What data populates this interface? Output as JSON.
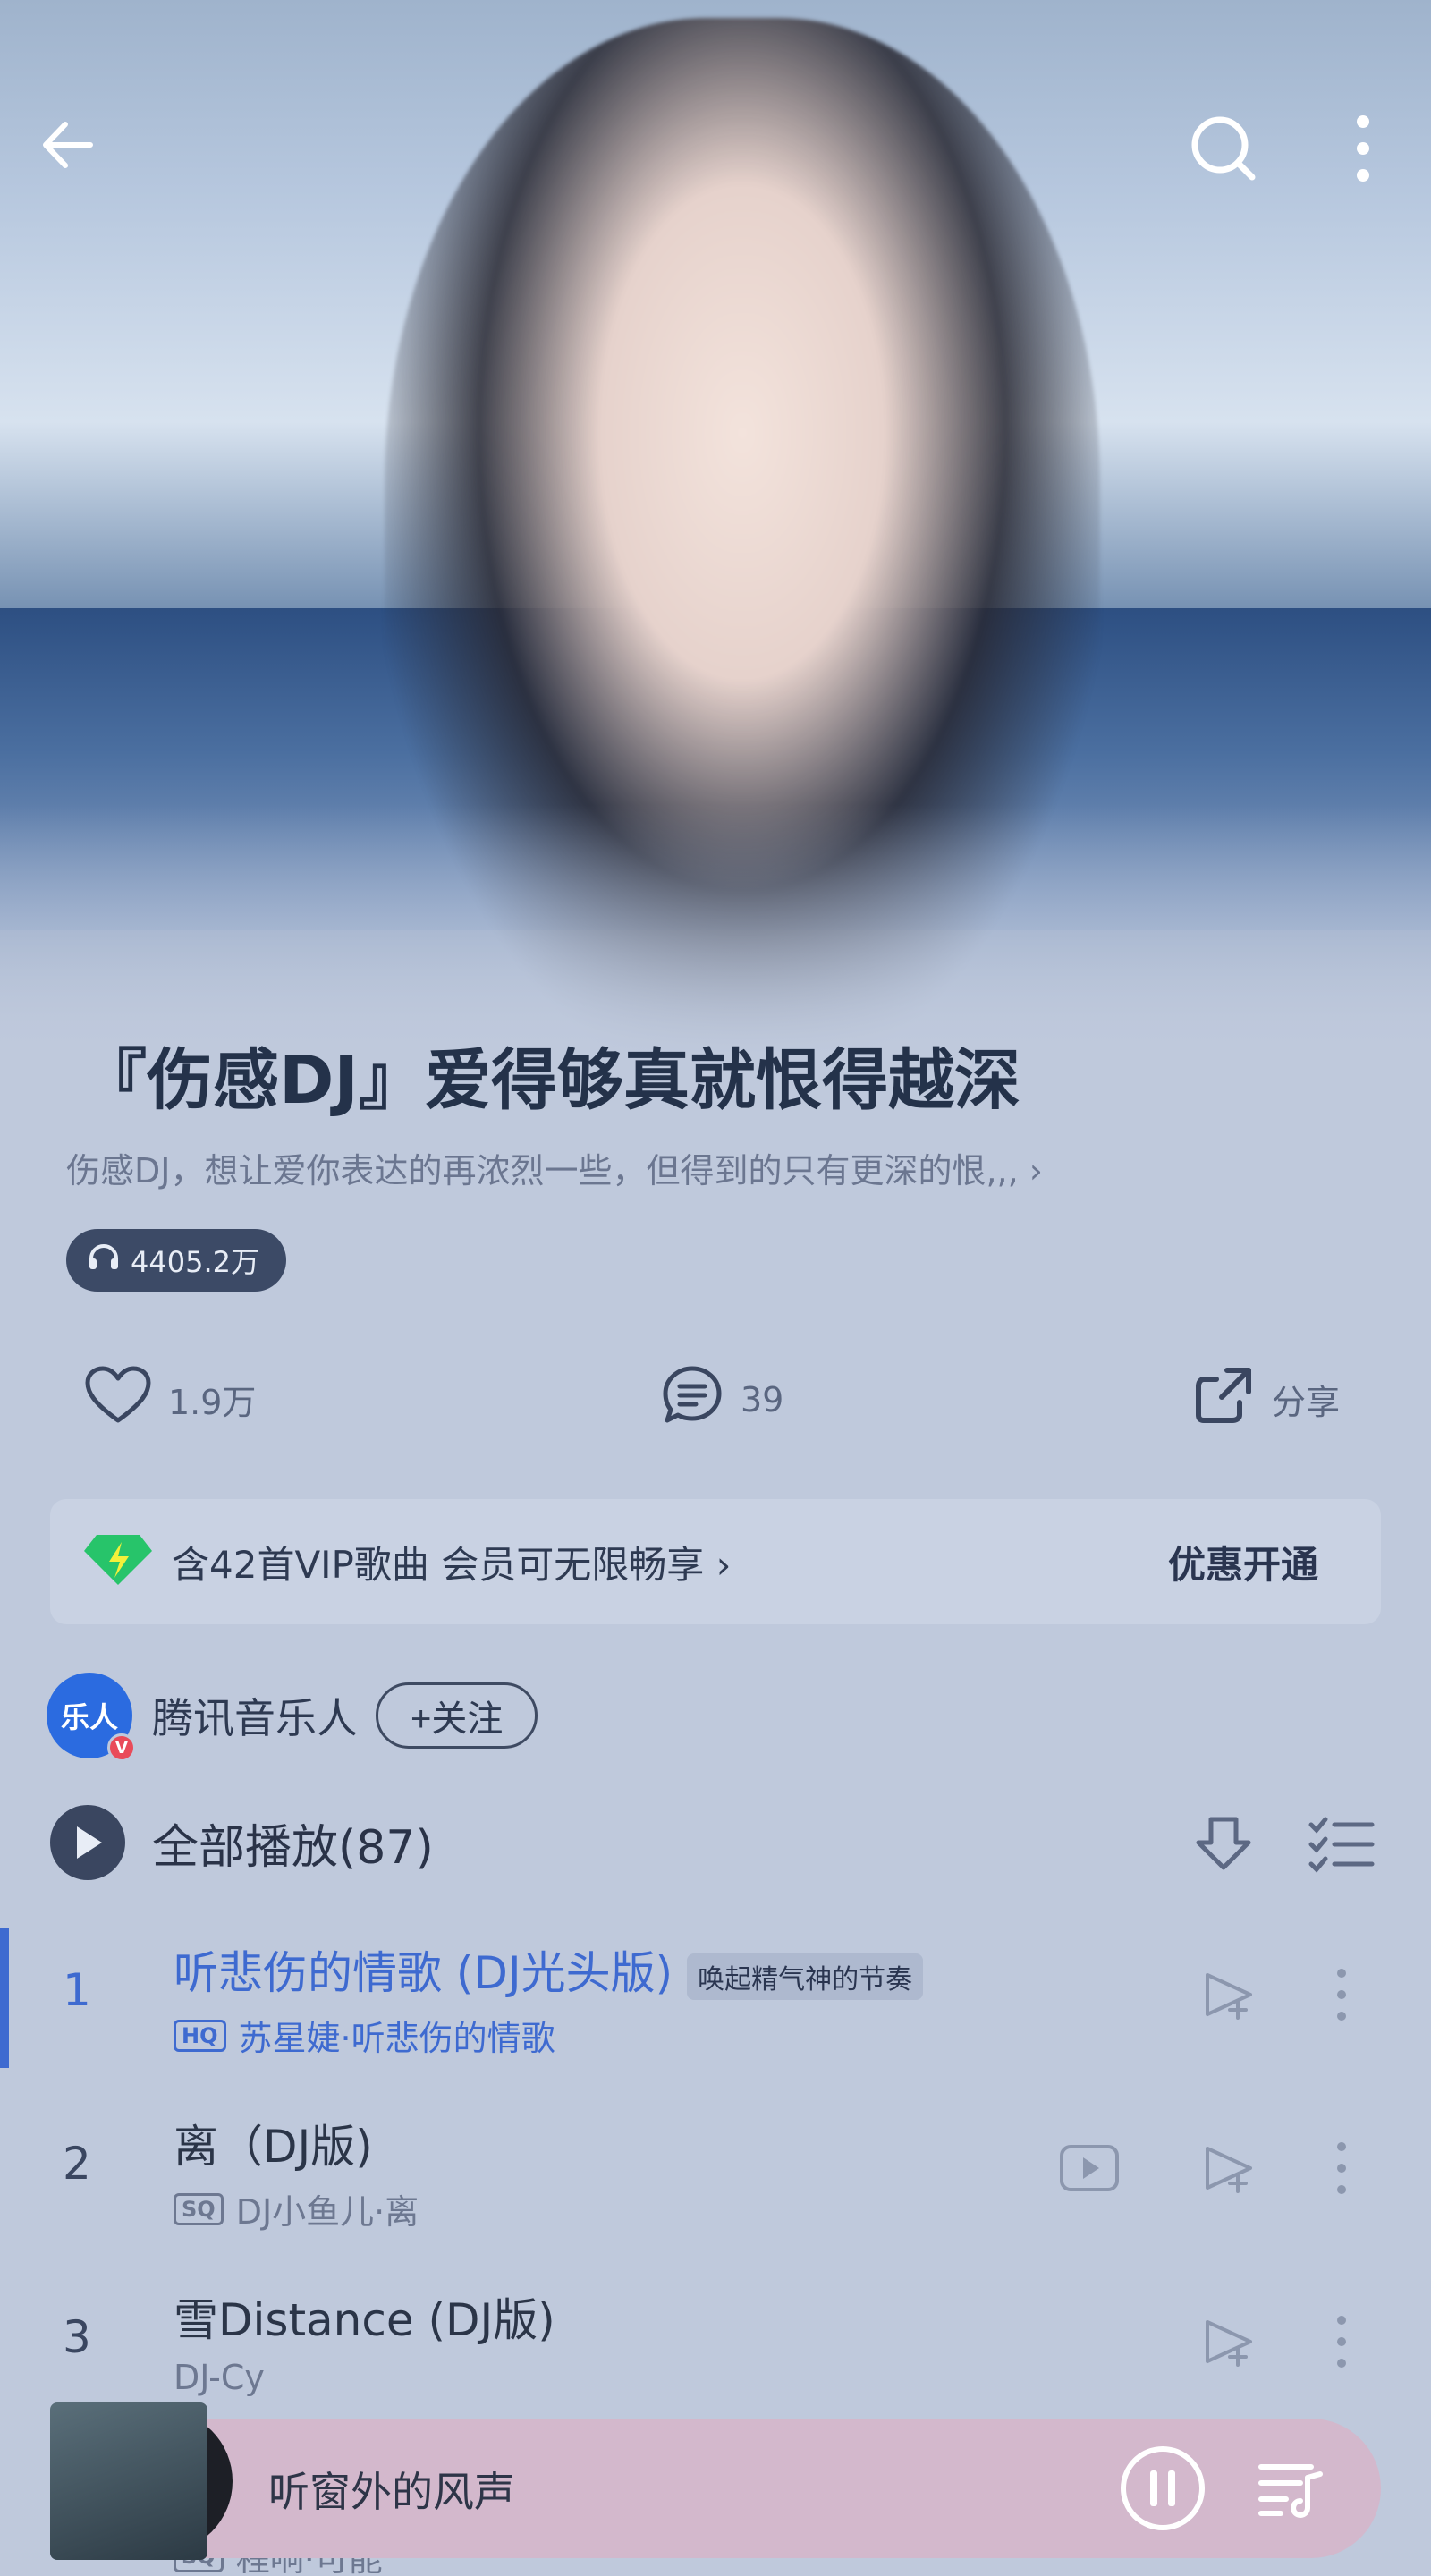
{
  "playlist": {
    "title": "『伤感DJ』爱得够真就恨得越深",
    "description": "伤感DJ，想让爱你表达的再浓烈一些，但得到的只有更深的恨,,, ›",
    "play_count": "4405.2万"
  },
  "actions": {
    "like_count": "1.9万",
    "comment_count": "39",
    "share_label": "分享"
  },
  "vip_banner": {
    "text": "含42首VIP歌曲 会员可无限畅享 ›",
    "cta": "优惠开通"
  },
  "creator": {
    "avatar_text": "乐人",
    "badge": "V",
    "name": "腾讯音乐人",
    "follow_label": "+关注"
  },
  "play_all": {
    "label": "全部播放(87)"
  },
  "songs": [
    {
      "num": "1",
      "title": "听悲伤的情歌 (DJ光头版)",
      "tag": "唤起精气神的节奏",
      "quality": "HQ",
      "subtitle": "苏星婕·听悲伤的情歌"
    },
    {
      "num": "2",
      "title": "离（DJ版)",
      "quality": "SQ",
      "subtitle": "DJ小鱼儿·离"
    },
    {
      "num": "3",
      "title": "雪Distance (DJ版)",
      "subtitle": "DJ-Cy"
    },
    {
      "num": "",
      "quality": "SQ",
      "subtitle": "程响·可能"
    }
  ],
  "mini_player": {
    "title": "听窗外的风声"
  },
  "colors": {
    "accent": "#3e6ad0",
    "background": "#bfc9dc",
    "mini_player_bg": "#d3b8cc"
  }
}
